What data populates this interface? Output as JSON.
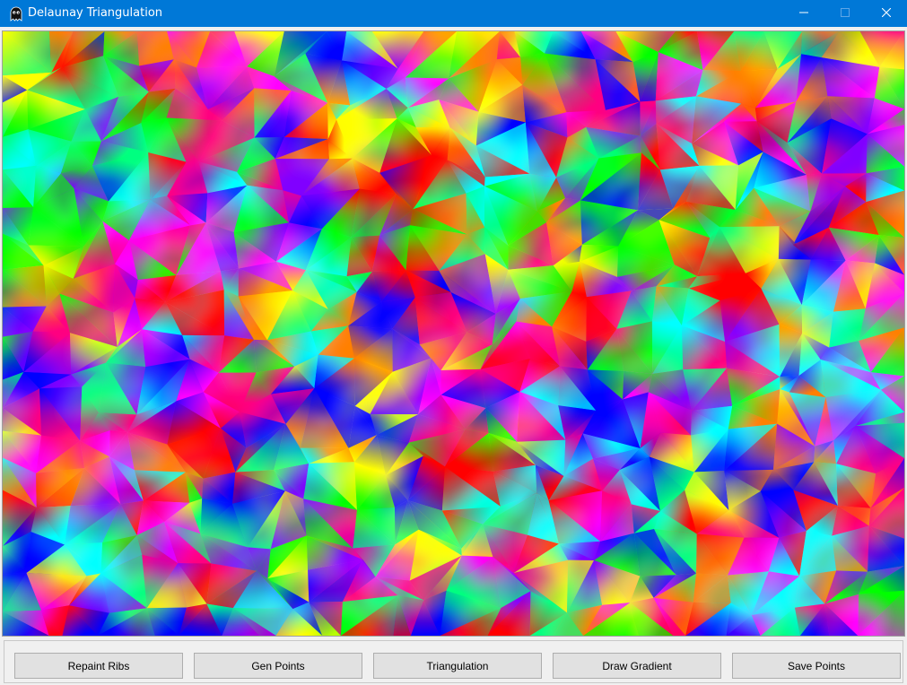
{
  "window": {
    "title": "Delaunay Triangulation",
    "icon": "ghost-icon",
    "controls": [
      "minimize-icon",
      "maximize-icon",
      "close-icon"
    ]
  },
  "canvas": {
    "content": "gradient-filled delaunay triangulation"
  },
  "toolbar": {
    "buttons": [
      {
        "label": "Repaint Ribs"
      },
      {
        "label": "Gen Points"
      },
      {
        "label": "Triangulation"
      },
      {
        "label": "Draw Gradient"
      },
      {
        "label": "Save Points"
      }
    ]
  },
  "colors": {
    "titlebar": "#0078d7",
    "window_bg": "#f0f0f0",
    "button_bg": "#e1e1e1",
    "button_border": "#adadad"
  }
}
